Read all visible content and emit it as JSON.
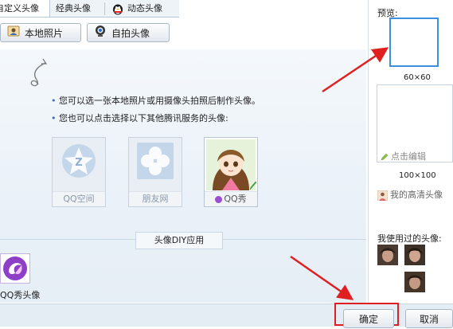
{
  "tabs": [
    {
      "label": "自定义头像",
      "active": true
    },
    {
      "label": "经典头像",
      "active": false
    },
    {
      "label": "动态头像",
      "active": false,
      "icon": "penguin-icon"
    }
  ],
  "toolbar": {
    "local_photo_label": "本地照片",
    "selfie_label": "自拍头像"
  },
  "instructions": [
    "您可以选一张本地照片或用摄像头拍照后制作头像。",
    "您也可以点击选择以下其他腾讯服务的头像:"
  ],
  "services": [
    {
      "label": "QQ空间",
      "icon": "qzone-star-icon"
    },
    {
      "label": "朋友网",
      "icon": "clover-icon"
    },
    {
      "label": "QQ秀",
      "icon": "qqshow-girl-avatar"
    }
  ],
  "diy_label": "头像DIY应用",
  "qqshow_avatar_label": "QQ秀头像",
  "preview": {
    "title": "预览:",
    "small_size": "60×60",
    "large_size": "100×100",
    "edit_label": "点击编辑",
    "hd_label": "我的高清头像",
    "used_label": "我使用过的头像:"
  },
  "buttons": {
    "ok": "确定",
    "cancel": "取消"
  },
  "colors": {
    "accent": "#3d8fe0",
    "annotation_red": "#e02020"
  }
}
